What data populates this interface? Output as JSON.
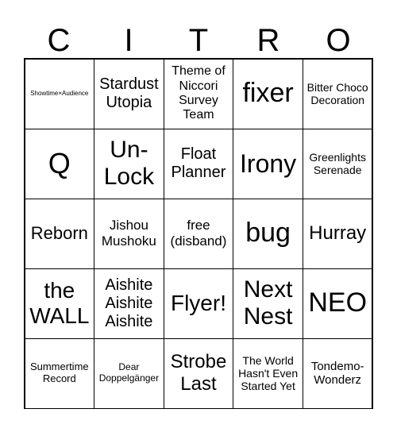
{
  "header": {
    "letters": [
      "C",
      "I",
      "T",
      "R",
      "O"
    ]
  },
  "cells": [
    "Showtime×Audience",
    "Stardust Utopia",
    "Theme of Niccori Survey Team",
    "fixer",
    "Bitter Choco Decoration",
    "Q",
    "Un-Lock",
    "Float Planner",
    "Irony",
    "Greenlights Serenade",
    "Reborn",
    "Jishou Mushoku",
    "free (disband)",
    "bug",
    "Hurray",
    "the WALL",
    "Aishite Aishite Aishite",
    "Flyer!",
    "Next Nest",
    "NEO",
    "Summertime Record",
    "Dear Doppelgänger",
    "Strobe Last",
    "The World Hasn't Even Started Yet",
    "Tondemo-Wonderz"
  ]
}
